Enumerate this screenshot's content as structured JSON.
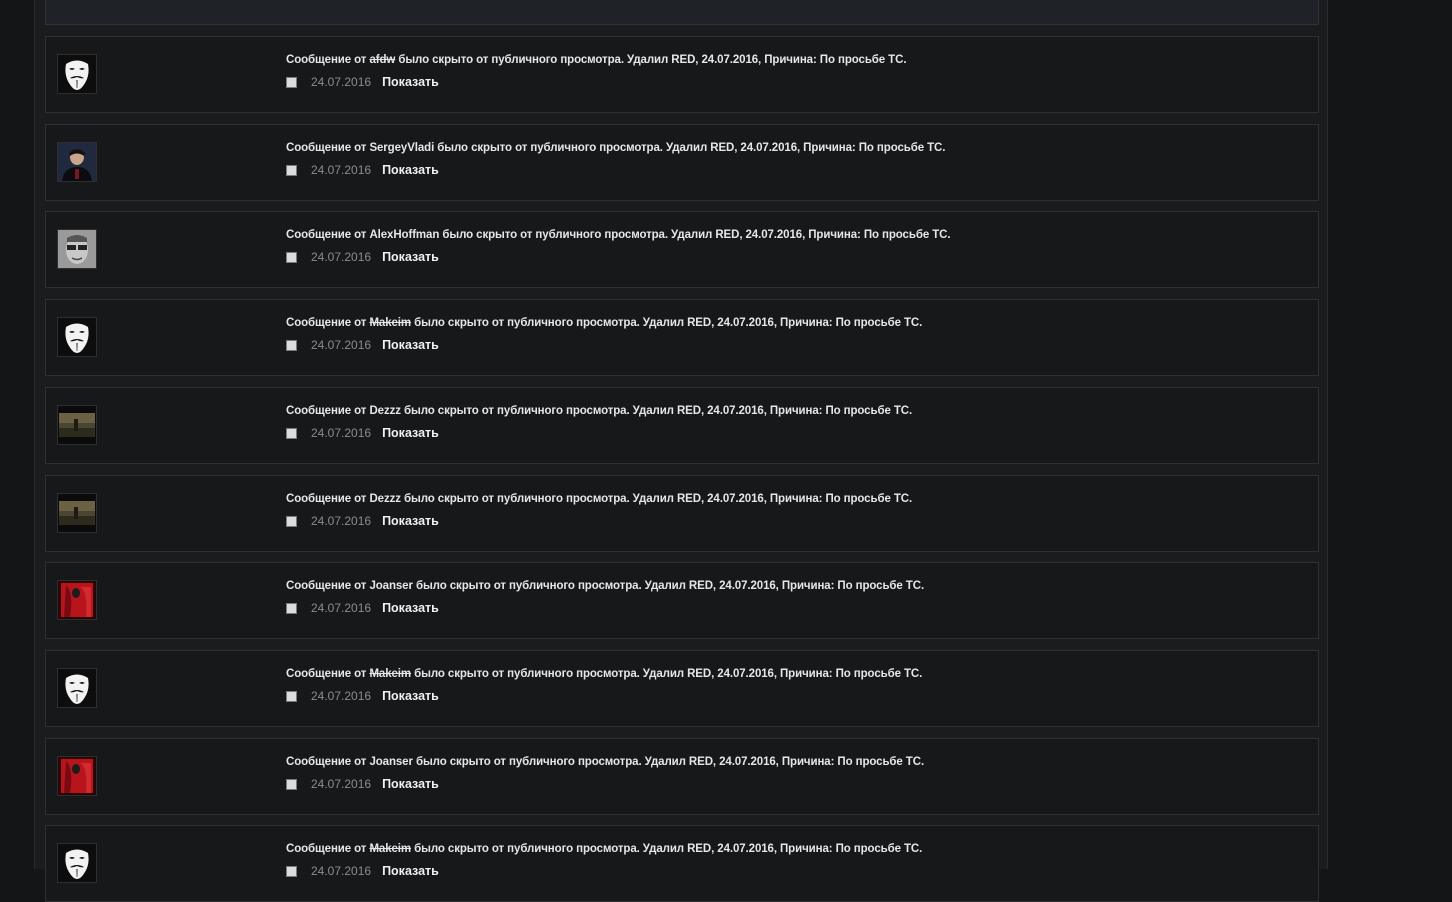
{
  "posts": [
    {
      "pre": "Сообщение от ",
      "user": "afdw",
      "struck": true,
      "post": " было скрыто от публичного просмотра. Удалил RED, 24.07.2016, Причина: По просьбе ТС.",
      "date": "24.07.2016",
      "action": "Показать",
      "avatar": "guy-fawkes-mask-icon"
    },
    {
      "pre": "Сообщение от ",
      "user": "SergeyVladi",
      "struck": false,
      "post": " было скрыто от публичного просмотра. Удалил RED, 24.07.2016, Причина: По просьбе ТС.",
      "date": "24.07.2016",
      "action": "Показать",
      "avatar": "user-photo-dark-blue"
    },
    {
      "pre": "Сообщение от ",
      "user": "AlexHoffman",
      "struck": false,
      "post": " было скрыто от публичного просмотра. Удалил RED, 24.07.2016, Причина: По просьбе ТС.",
      "date": "24.07.2016",
      "action": "Показать",
      "avatar": "user-photo-grayscale-face"
    },
    {
      "pre": "Сообщение от ",
      "user": "Makeim",
      "struck": true,
      "post": " было скрыто от публичного просмотра. Удалил RED, 24.07.2016, Причина: По просьбе ТС.",
      "date": "24.07.2016",
      "action": "Показать",
      "avatar": "guy-fawkes-mask-icon"
    },
    {
      "pre": "Сообщение от ",
      "user": "Dezzz",
      "struck": false,
      "post": " было скрыто от публичного просмотра. Удалил RED, 24.07.2016, Причина: По просьбе ТС.",
      "date": "24.07.2016",
      "action": "Показать",
      "avatar": "user-photo-landscape"
    },
    {
      "pre": "Сообщение от ",
      "user": "Dezzz",
      "struck": false,
      "post": " было скрыто от публичного просмотра. Удалил RED, 24.07.2016, Причина: По просьбе ТС.",
      "date": "24.07.2016",
      "action": "Показать",
      "avatar": "user-photo-landscape"
    },
    {
      "pre": "Сообщение от ",
      "user": "Joanser",
      "struck": false,
      "post": " было скрыто от публичного просмотра. Удалил RED, 24.07.2016, Причина: По просьбе ТС.",
      "date": "24.07.2016",
      "action": "Показать",
      "avatar": "user-photo-red"
    },
    {
      "pre": "Сообщение от ",
      "user": "Makeim",
      "struck": true,
      "post": " было скрыто от публичного просмотра. Удалил RED, 24.07.2016, Причина: По просьбе ТС.",
      "date": "24.07.2016",
      "action": "Показать",
      "avatar": "guy-fawkes-mask-icon"
    },
    {
      "pre": "Сообщение от ",
      "user": "Joanser",
      "struck": false,
      "post": " было скрыто от публичного просмотра. Удалил RED, 24.07.2016, Причина: По просьбе ТС.",
      "date": "24.07.2016",
      "action": "Показать",
      "avatar": "user-photo-red"
    },
    {
      "pre": "Сообщение от ",
      "user": "Makeim",
      "struck": true,
      "post": " было скрыто от публичного просмотра. Удалил RED, 24.07.2016, Причина: По просьбе ТС.",
      "date": "24.07.2016",
      "action": "Показать",
      "avatar": "guy-fawkes-mask-icon"
    }
  ],
  "colors": {
    "background": "#141516",
    "row_bg": "#17181a",
    "row_border": "#2e3033",
    "text": "#e6e6e6",
    "date": "#8c8c8c"
  }
}
